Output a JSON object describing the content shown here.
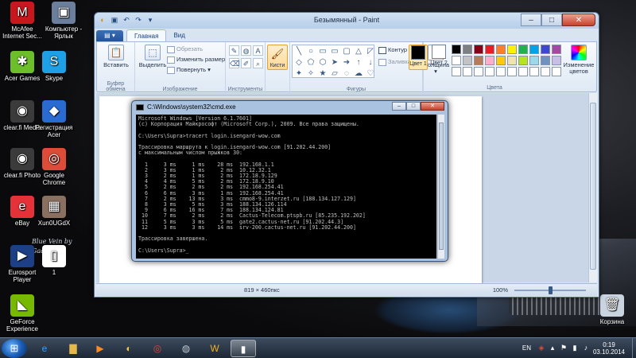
{
  "desktop": {
    "icons": [
      {
        "label": "McAfee Internet Sec...",
        "color": "#c8171d",
        "glyph": "M"
      },
      {
        "label": "Компьютер - Ярлык",
        "color": "#6b7f9c",
        "glyph": "▣"
      },
      {
        "label": "Acer Games",
        "color": "#6cbf2a",
        "glyph": "✱"
      },
      {
        "label": "Skype",
        "color": "#1ea0e6",
        "glyph": "S"
      },
      {
        "label": "clear.fi Media",
        "color": "#3b3b3b",
        "glyph": "◉"
      },
      {
        "label": "Регистрация Acer",
        "color": "#2a6bd1",
        "glyph": "◆"
      },
      {
        "label": "clear.fi Photo",
        "color": "#3b3b3b",
        "glyph": "◉"
      },
      {
        "label": "Google Chrome",
        "color": "#dd4b39",
        "glyph": "◎"
      },
      {
        "label": "eBay",
        "color": "#e53238",
        "glyph": "e"
      },
      {
        "label": "Xun0UGdX",
        "color": "#8a7060",
        "glyph": "▦"
      },
      {
        "label": "Eurosport Player",
        "color": "#1c3f86",
        "glyph": "▶"
      },
      {
        "label": "1",
        "color": "#ffffff",
        "glyph": "▯"
      },
      {
        "label": "GeForce Experience",
        "color": "#76b900",
        "glyph": "◣"
      },
      {
        "label": "Корзина",
        "color": "#c9d4e0",
        "glyph": "🗑"
      }
    ],
    "wallpaper_text": "Blue Vein by Gaan"
  },
  "paint": {
    "title": "Безымянный - Paint",
    "qat_icons": [
      "save-icon",
      "undo-icon",
      "redo-icon"
    ],
    "window_buttons": {
      "min": "–",
      "max": "□",
      "close": "✕"
    },
    "file_tab": "▤ ▾",
    "tabs": [
      "Главная",
      "Вид"
    ],
    "active_tab": "Главная",
    "clipboard": {
      "paste": "Вставить",
      "label": "Буфер обмена"
    },
    "image": {
      "select": "Выделить",
      "crop": "Обрезать",
      "resize": "Изменить размер",
      "rotate": "Повернуть",
      "label": "Изображение"
    },
    "tools": {
      "label": "Инструменты",
      "icons": [
        "✎",
        "◍",
        "A",
        "⌫",
        "✐",
        "⌕"
      ]
    },
    "brushes": {
      "label": "Кисти"
    },
    "shapes": {
      "label": "Фигуры",
      "outline": "Контур",
      "fill": "Заливка",
      "glyphs": [
        "╲",
        "○",
        "▭",
        "▭",
        "▢",
        "△",
        "◸",
        "◇",
        "⬠",
        "⬡",
        "➤",
        "➜",
        "↑",
        "↓",
        "✦",
        "✧",
        "★",
        "▱",
        "◌",
        "☁",
        "♡"
      ]
    },
    "size": {
      "label": "Толщина"
    },
    "color1": {
      "label": "Цвет 1",
      "value": "#000000"
    },
    "color2": {
      "label": "Цвет 2",
      "value": "#ffffff"
    },
    "colors_label": "Цвета",
    "edit_colors": "Изменение цветов",
    "palette": [
      "#000000",
      "#7f7f7f",
      "#880015",
      "#ed1c24",
      "#ff7f27",
      "#fff200",
      "#22b14c",
      "#00a2e8",
      "#3f48cc",
      "#a349a4",
      "#ffffff",
      "#c3c3c3",
      "#b97a57",
      "#ffaec9",
      "#ffc90e",
      "#efe4b0",
      "#b5e61d",
      "#99d9ea",
      "#7092be",
      "#c8bfe7",
      "#ffffff",
      "#ffffff",
      "#ffffff",
      "#ffffff",
      "#ffffff",
      "#ffffff",
      "#ffffff",
      "#ffffff",
      "#ffffff",
      "#ffffff"
    ],
    "status": {
      "size": "819 × 460пкс",
      "zoom": "100%"
    }
  },
  "cmd": {
    "title": "C:\\Windows\\system32\\cmd.exe",
    "output": "Microsoft Windows [Version 6.1.7601]\n(c) Корпорация Майкрософт (Microsoft Corp.), 2009. Все права защищены.\n\nC:\\Users\\Supra>tracert login.isengard-wow.com\n\nТрассировка маршрута к login.isengard-wow.com [91.202.44.200]\nс максимальным числом прыжков 30:\n\n  1     3 ms     1 ms    28 ms  192.168.1.1\n  2     3 ms     1 ms     2 ms  10.12.32.1\n  3     2 ms     1 ms     2 ms  172.18.9.129\n  4     4 ms     5 ms     2 ms  172.18.9.10\n  5     2 ms     2 ms     2 ms  192.168.254.41\n  6     6 ms     3 ms     1 ms  192.168.254.41\n  7     2 ms    13 ms     3 ms  cmmo8-9.interzet.ru [188.134.127.129]\n  8     3 ms     5 ms     3 ms  188.134.126.114\n  9     6 ms    16 ms     7 ms  188.134.124.81\n 10     7 ms     2 ms     2 ms  Cactus-Telecom.ptspb.ru [85.235.192.202]\n 11     5 ms     3 ms     5 ms  gate2.cactus-net.ru [91.202.44.3]\n 12     3 ms     3 ms    14 ms  srv-200.cactus-net.ru [91.202.44.200]\n\nТрассировка завершена.\n\nC:\\Users\\Supra>_",
    "buttons": {
      "min": "–",
      "max": "□",
      "close": "✕"
    }
  },
  "taskbar": {
    "apps": [
      {
        "name": "ie",
        "glyph": "e",
        "color": "#3aa0ff"
      },
      {
        "name": "explorer",
        "glyph": "▇",
        "color": "#e5b84a"
      },
      {
        "name": "media-player",
        "glyph": "▶",
        "color": "#ff8a1e"
      },
      {
        "name": "paint",
        "glyph": "◐",
        "color": "#f0c34a"
      },
      {
        "name": "chrome",
        "glyph": "◎",
        "color": "#e0453a"
      },
      {
        "name": "app-sphere",
        "glyph": "◍",
        "color": "#c0c8d0"
      },
      {
        "name": "wow",
        "glyph": "W",
        "color": "#f0b020"
      },
      {
        "name": "cmd",
        "glyph": "▮",
        "color": "#ffffff"
      }
    ],
    "lang": "EN",
    "time": "0:19",
    "date": "03.10.2014"
  }
}
